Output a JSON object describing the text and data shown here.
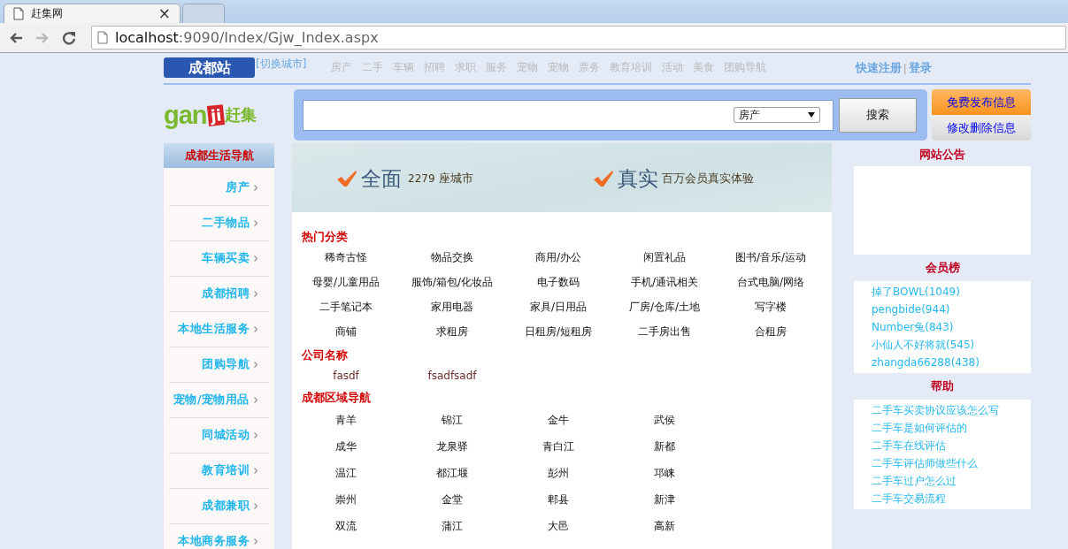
{
  "browser": {
    "tabs": [
      {
        "title": "赶集网",
        "close": "×",
        "selected": true
      },
      {
        "selected": false
      }
    ],
    "nav_buttons": [
      {
        "kind": "back",
        "disabled": false
      },
      {
        "kind": "forward",
        "disabled": true
      },
      {
        "kind": "reload",
        "disabled": false
      }
    ],
    "address": {
      "host": "localhost",
      "path": ":9090/Index/Gjw_Index.aspx"
    }
  },
  "topbar": {
    "city": "成都站",
    "switch_city": "[切换城市]",
    "nav": [
      "房产",
      "二手",
      "车辆",
      "招聘",
      "求职",
      "服务",
      "宠物",
      "宠物",
      "票务",
      "教育培训",
      "活动",
      "美食",
      "团购导航"
    ],
    "register": "快速注册",
    "separator": "|",
    "login": "登录"
  },
  "logo": {
    "part_1": "gan",
    "part_2": "ji",
    "part_3": "赶集"
  },
  "search": {
    "category": "房产",
    "button": "搜索"
  },
  "actions": [
    "免费发布信息",
    "修改删除信息"
  ],
  "sidebar": {
    "title": "成都生活导航",
    "items": [
      "房产",
      "二手物品",
      "车辆买卖",
      "成都招聘",
      "本地生活服务",
      "团购导航",
      "宠物/宠物用品",
      "同城活动",
      "教育培训",
      "成都兼职",
      "本地商务服务"
    ]
  },
  "banner": [
    {
      "title": "全面",
      "number": "2279",
      "text": "座城市"
    },
    {
      "title": "真实",
      "text": "百万会员真实体验"
    }
  ],
  "sections": [
    {
      "title": "热门分类",
      "kind": "category",
      "items": [
        "稀奇古怪",
        "物品交换",
        "商用/办公",
        "闲置礼品",
        "图书/音乐/运动",
        "母婴/儿童用品",
        "服饰/箱包/化妆品",
        "电子数码",
        "手机/通讯相关",
        "台式电脑/网络",
        "二手笔记本",
        "家用电器",
        "家具/日用品",
        "厂房/仓库/土地",
        "写字楼",
        "商铺",
        "求租房",
        "日租房/短租房",
        "二手房出售",
        "合租房"
      ]
    },
    {
      "title": "公司名称",
      "kind": "company",
      "items": [
        "fasdf",
        "fsadfsadf"
      ]
    },
    {
      "title": "成都区域导航",
      "kind": "region",
      "items": [
        "青羊",
        "锦江",
        "金牛",
        "武侯",
        "成华",
        "龙泉驿",
        "青白江",
        "新都",
        "温江",
        "都江堰",
        "彭州",
        "邛崃",
        "崇州",
        "金堂",
        "郫县",
        "新津",
        "双流",
        "蒲江",
        "大邑",
        "高新"
      ]
    }
  ],
  "right": [
    {
      "title": "网站公告",
      "kind": "notice"
    },
    {
      "title": "会员榜",
      "kind": "list",
      "items": [
        "掉了BOWL(1049)",
        "pengbide(944)",
        "Number兔(843)",
        "小仙人不好将就(545)",
        "zhangda66288(438)"
      ]
    },
    {
      "title": "帮助",
      "kind": "list",
      "items": [
        "二手车买卖协议应该怎么写",
        "二手车是如何评估的",
        "二手车在线评估",
        "二手车评估师做些什么",
        "二手车过户怎么过",
        "二手车交易流程"
      ]
    }
  ]
}
